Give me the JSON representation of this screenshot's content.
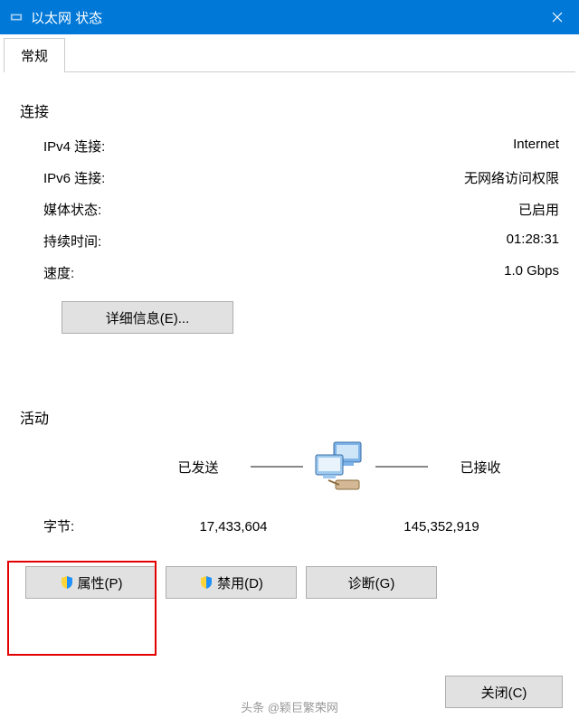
{
  "titlebar": {
    "title": "以太网 状态"
  },
  "tabs": {
    "general": "常规"
  },
  "connection": {
    "heading": "连接",
    "ipv4_label": "IPv4 连接:",
    "ipv4_value": "Internet",
    "ipv6_label": "IPv6 连接:",
    "ipv6_value": "无网络访问权限",
    "media_label": "媒体状态:",
    "media_value": "已启用",
    "duration_label": "持续时间:",
    "duration_value": "01:28:31",
    "speed_label": "速度:",
    "speed_value": "1.0 Gbps",
    "details_btn": "详细信息(E)..."
  },
  "activity": {
    "heading": "活动",
    "sent_label": "已发送",
    "recv_label": "已接收",
    "bytes_label": "字节:",
    "bytes_sent": "17,433,604",
    "bytes_recv": "145,352,919"
  },
  "buttons": {
    "properties": "属性(P)",
    "disable": "禁用(D)",
    "diagnose": "诊断(G)",
    "close": "关闭(C)"
  },
  "watermark": "头条 @颖巨繁荣网"
}
